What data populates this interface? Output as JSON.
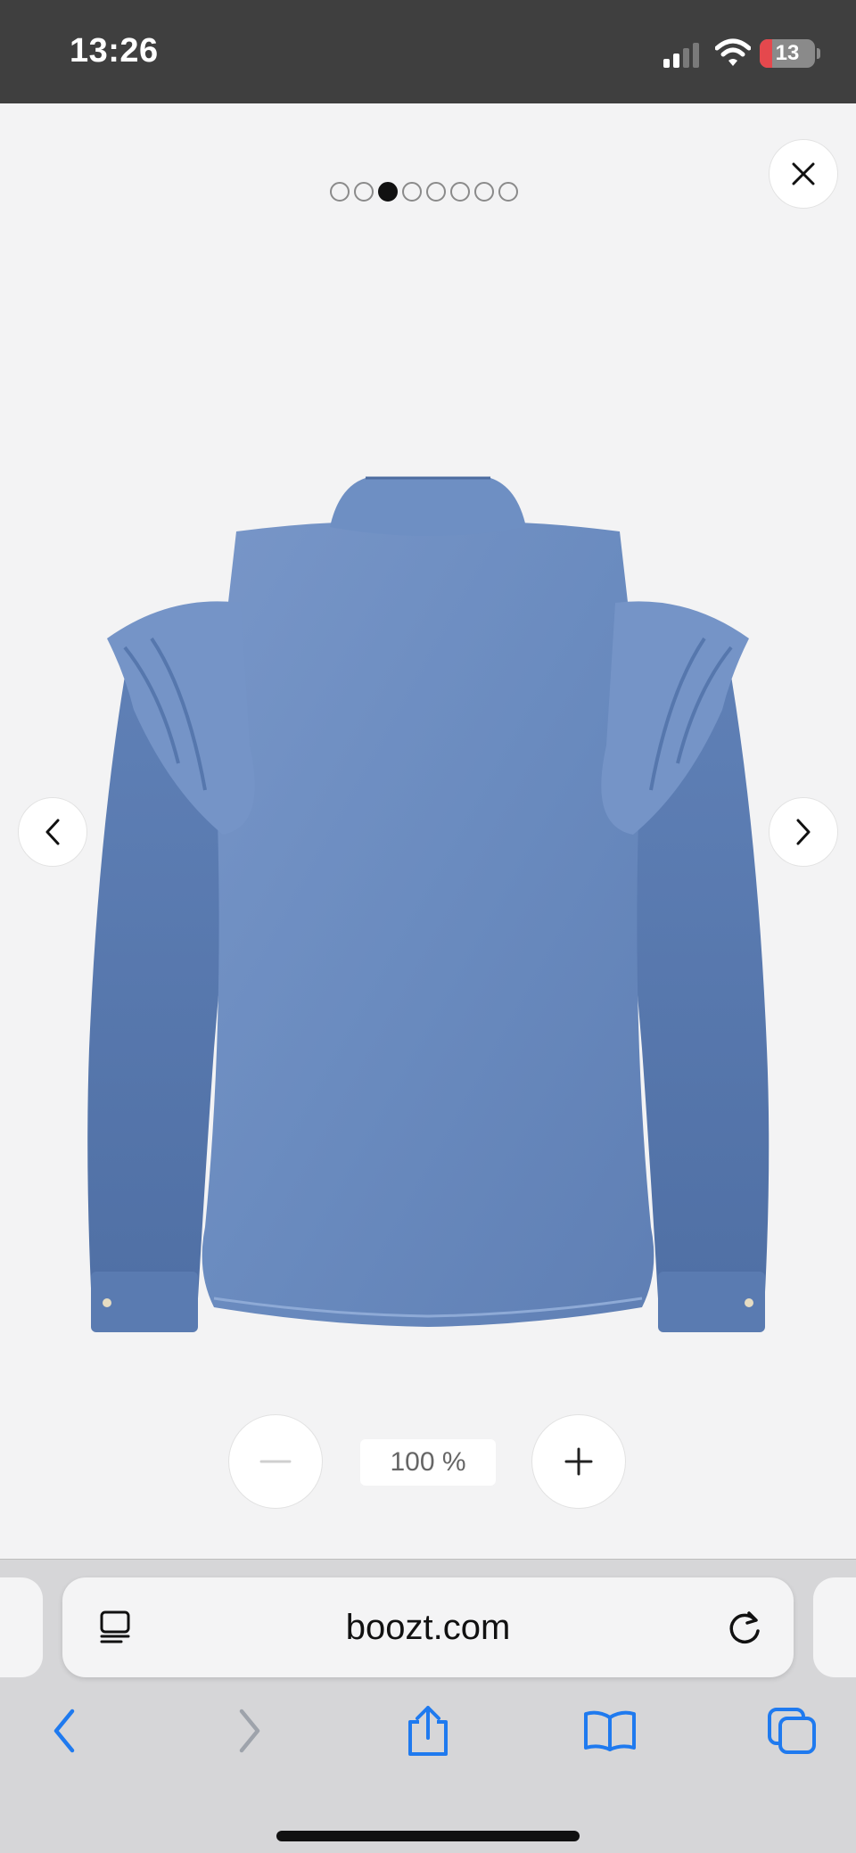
{
  "status_bar": {
    "time": "13:26",
    "battery_level": "13",
    "signal_icon": "cellular-signal-icon",
    "wifi_icon": "wifi-icon",
    "battery_color": "#e5484d"
  },
  "gallery": {
    "dot_count": 8,
    "active_index": 2,
    "close_icon": "close-icon",
    "prev_icon": "chevron-left-icon",
    "next_icon": "chevron-right-icon",
    "product_image": "denim-ruffle-shirt-back-view",
    "product_color": "#6f8fc0"
  },
  "zoom": {
    "level": "100 %",
    "minus_icon": "minus-icon",
    "plus_icon": "plus-icon"
  },
  "browser": {
    "url": "boozt.com",
    "reader_icon": "reader-mode-icon",
    "reload_icon": "reload-icon",
    "toolbar": [
      "back-icon",
      "forward-icon",
      "share-icon",
      "bookmarks-icon",
      "tabs-icon"
    ],
    "accent": "#1f7aef"
  }
}
